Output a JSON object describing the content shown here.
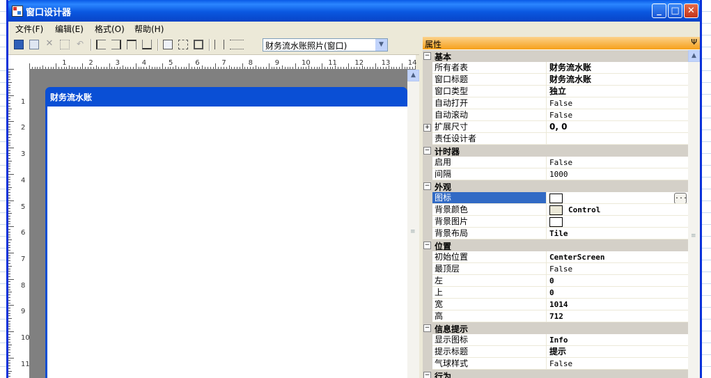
{
  "window": {
    "title": "窗口设计器",
    "min_glyph": "_",
    "max_glyph": "□",
    "close_glyph": "✕"
  },
  "menu": [
    "文件(F)",
    "编辑(E)",
    "格式(O)",
    "帮助(H)"
  ],
  "toolbar": {
    "combo_value": "财务流水账照片(窗口)",
    "combo_arrow": "▼"
  },
  "ruler": {
    "h": [
      "1",
      "2",
      "3",
      "4",
      "5",
      "6",
      "7",
      "8",
      "9",
      "10",
      "11",
      "12",
      "13",
      "14"
    ],
    "v": [
      "1",
      "2",
      "3",
      "4",
      "5",
      "6",
      "7",
      "8",
      "9",
      "10",
      "11"
    ]
  },
  "designer": {
    "form_title": "财务流水账",
    "scroll_up": "▲",
    "scroll_grip": "≡"
  },
  "properties": {
    "title": "属性",
    "pin_glyph": "Ψ",
    "collapse_glyph": "−",
    "expand_glyph": "+",
    "ellipsis": "...",
    "categories": [
      {
        "name": "基本",
        "rows": [
          {
            "name": "所有者表",
            "value": "财务流水账",
            "style": "bold"
          },
          {
            "name": "窗口标题",
            "value": "财务流水账",
            "style": "bold"
          },
          {
            "name": "窗口类型",
            "value": "独立",
            "style": "bold"
          },
          {
            "name": "自动打开",
            "value": "False",
            "style": "plain"
          },
          {
            "name": "自动滚动",
            "value": "False",
            "style": "plain"
          },
          {
            "name": "扩展尺寸",
            "value": "0, 0",
            "style": "bold",
            "expandable": true
          },
          {
            "name": "责任设计者",
            "value": "",
            "style": "plain"
          }
        ]
      },
      {
        "name": "计时器",
        "rows": [
          {
            "name": "启用",
            "value": "False",
            "style": "plain"
          },
          {
            "name": "间隔",
            "value": "1000",
            "style": "plain"
          }
        ]
      },
      {
        "name": "外观",
        "rows": [
          {
            "name": "图标",
            "value": "",
            "style": "plain",
            "swatch": "#ffffff",
            "selected": true,
            "button": true
          },
          {
            "name": "背景颜色",
            "value": "Control",
            "style": "bold-mono",
            "swatch": "#ece9d8"
          },
          {
            "name": "背景图片",
            "value": "",
            "style": "plain",
            "swatch": "#ffffff"
          },
          {
            "name": "背景布局",
            "value": "Tile",
            "style": "bold-mono"
          }
        ]
      },
      {
        "name": "位置",
        "rows": [
          {
            "name": "初始位置",
            "value": "CenterScreen",
            "style": "bold-mono"
          },
          {
            "name": "最顶层",
            "value": "False",
            "style": "plain"
          },
          {
            "name": "左",
            "value": "0",
            "style": "bold-mono"
          },
          {
            "name": "上",
            "value": "0",
            "style": "bold-mono"
          },
          {
            "name": "宽",
            "value": "1014",
            "style": "bold-mono"
          },
          {
            "name": "高",
            "value": "712",
            "style": "bold-mono"
          }
        ]
      },
      {
        "name": "信息提示",
        "rows": [
          {
            "name": "显示图标",
            "value": "Info",
            "style": "bold-mono"
          },
          {
            "name": "提示标题",
            "value": "提示",
            "style": "bold"
          },
          {
            "name": "气球样式",
            "value": "False",
            "style": "plain"
          }
        ]
      },
      {
        "name": "行为",
        "rows": []
      }
    ]
  },
  "colors": {
    "title_blue": "#0a5ae6",
    "selection": "#316ac5",
    "header_orange": "#f6a01a"
  }
}
